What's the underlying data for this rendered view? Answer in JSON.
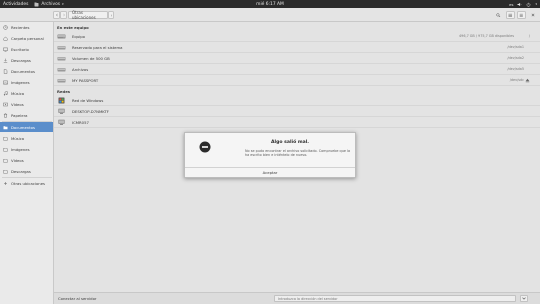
{
  "topbar": {
    "activities": "Actividades",
    "app_name": "Archivos",
    "clock": "mié  6:17 AM",
    "keyboard_layout": "es"
  },
  "headerbar": {
    "path_label": "Otras ubicaciones"
  },
  "sidebar": {
    "items": [
      {
        "label": "Recientes",
        "icon": "clock-icon"
      },
      {
        "label": "Carpeta personal",
        "icon": "home-icon"
      },
      {
        "label": "Escritorio",
        "icon": "desktop-folder-icon"
      },
      {
        "label": "Descargas",
        "icon": "download-icon"
      },
      {
        "label": "Documentos",
        "icon": "documents-icon"
      },
      {
        "label": "Imágenes",
        "icon": "pictures-icon"
      },
      {
        "label": "Música",
        "icon": "music-icon"
      },
      {
        "label": "Vídeos",
        "icon": "video-icon"
      },
      {
        "label": "Papelera",
        "icon": "trash-icon"
      },
      {
        "label": "Documentos",
        "icon": "documents-icon"
      },
      {
        "label": "Música",
        "icon": "music-icon"
      },
      {
        "label": "Imágenes",
        "icon": "pictures-icon"
      },
      {
        "label": "Vídeos",
        "icon": "video-icon"
      },
      {
        "label": "Descargas",
        "icon": "download-icon"
      },
      {
        "label": "Otras ubicaciones",
        "icon": "plus-icon"
      }
    ],
    "active_index": 9,
    "active_color": "#5b8ecb"
  },
  "main": {
    "section_computer": "En este equipo",
    "section_networks": "Redes",
    "computer_rows": [
      {
        "name": "Equipo",
        "info": "496,7 GB / 975,7 GB disponibles",
        "path": "/",
        "icon": "harddisk-icon",
        "usage": 0.49
      },
      {
        "name": "Reservado para el sistema",
        "info": "",
        "path": "/dev/sda1",
        "icon": "drive-icon"
      },
      {
        "name": "Volumen de 500 GB",
        "info": "",
        "path": "/dev/sda2",
        "icon": "drive-icon"
      },
      {
        "name": "Archivos",
        "info": "",
        "path": "/dev/sda5",
        "icon": "drive-icon"
      },
      {
        "name": "MY PASSPORT",
        "info": "",
        "path": "/dev/sdc",
        "icon": "drive-icon",
        "eject": true
      }
    ],
    "network_rows": [
      {
        "name": "Red de Windows",
        "icon": "windows-network-icon"
      },
      {
        "name": "DESKTOP-D7NMKTF",
        "icon": "network-computer-icon"
      },
      {
        "name": "ICMR057",
        "icon": "network-computer-icon"
      }
    ]
  },
  "bottombar": {
    "connect_label": "Conectar al servidor",
    "address_placeholder": "Introduzca la dirección del servidor"
  },
  "dialog": {
    "title": "Algo salió mal.",
    "message": "No se pudo encontrar el archivo solicitado. Compruebe que la ha escrito bien e inténtelo de nuevo.",
    "button": "Aceptar"
  }
}
